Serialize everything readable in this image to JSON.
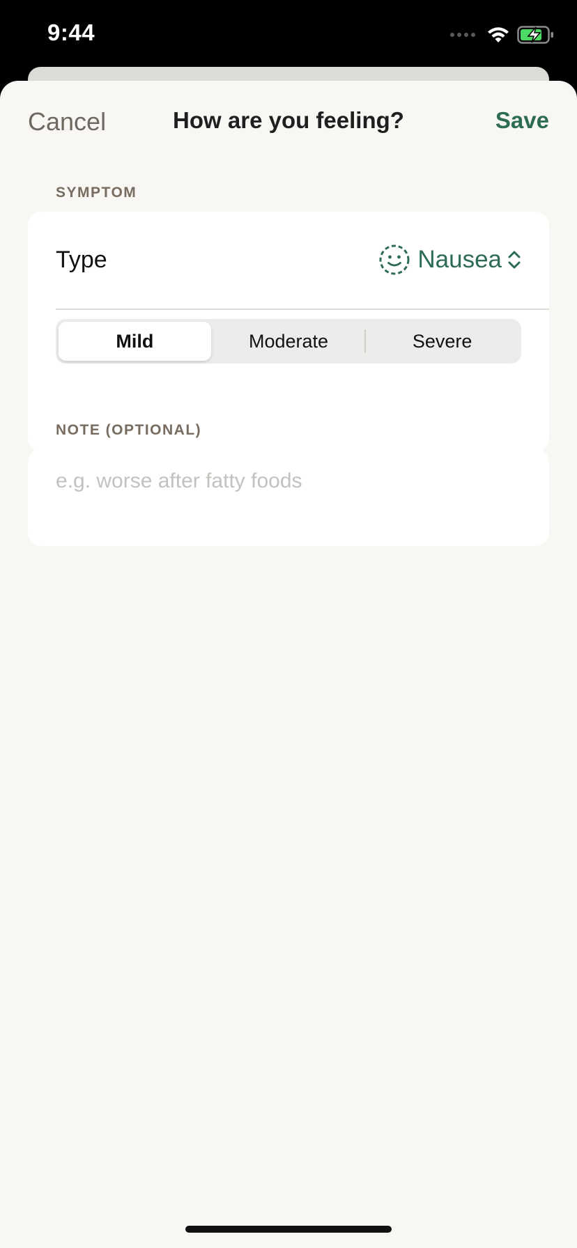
{
  "status_bar": {
    "time": "9:44",
    "icons": [
      "cellular-dots-icon",
      "wifi-icon",
      "battery-charging-icon"
    ]
  },
  "nav": {
    "cancel_label": "Cancel",
    "title": "How are you feeling?",
    "save_label": "Save"
  },
  "symptom_section": {
    "header": "SYMPTOM",
    "type_label": "Type",
    "type_value": "Nausea",
    "type_icon": "dashed-smiley-icon",
    "severity_options": [
      "Mild",
      "Moderate",
      "Severe"
    ],
    "severity_selected": "Mild"
  },
  "note_section": {
    "header": "NOTE (OPTIONAL)",
    "value": "",
    "placeholder": "e.g. worse after fatty foods"
  },
  "colors": {
    "accent": "#2e6b54",
    "background": "#f8f7f4",
    "card": "#ffffff",
    "section_header": "#776c5f"
  }
}
